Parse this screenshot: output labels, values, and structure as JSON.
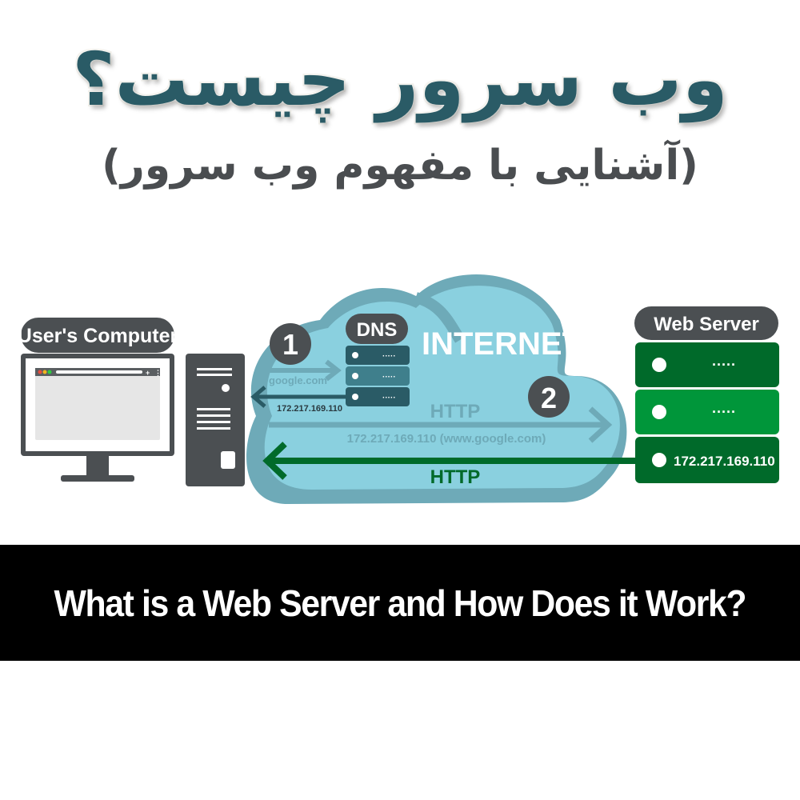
{
  "header": {
    "title_fa": "وب سرور چیست؟",
    "subtitle_fa": "(آشنایی با مفهوم وب سرور)"
  },
  "diagram": {
    "users_computer_label": "User's Computer",
    "dns_label": "DNS",
    "internet_label": "INTERNET",
    "web_server_label": "Web Server",
    "step_1": "1",
    "step_2": "2",
    "dns_request_text": "google.com",
    "dns_response_text": "172.217.169.110",
    "http_request_label": "HTTP",
    "http_request_text": "172.217.169.110 (www.google.com)",
    "http_response_label": "HTTP",
    "server_ip": "172.217.169.110",
    "colors": {
      "dark_gray": "#4b4f52",
      "cloud": "#8ad0df",
      "cloud_shadow": "#6eaab8",
      "dns_dark": "#2a5b66",
      "dns_mid": "#3f7f8c",
      "server_dark": "#006a2a",
      "server_light": "#00963a",
      "http_green": "#006a2a",
      "faded_arrow": "#6eaab8"
    }
  },
  "banner": {
    "text": "What is a Web Server and How Does it Work?"
  }
}
